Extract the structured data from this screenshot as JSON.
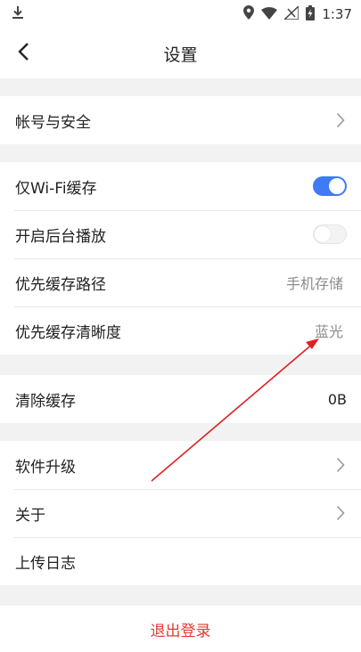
{
  "status_bar": {
    "time": "1:37"
  },
  "header": {
    "title": "设置"
  },
  "groups": [
    {
      "items": [
        {
          "label": "帐号与安全"
        }
      ]
    },
    {
      "items": [
        {
          "label": "仅Wi-Fi缓存",
          "toggle_on": true
        },
        {
          "label": "开启后台播放",
          "toggle_on": false
        },
        {
          "label": "优先缓存路径",
          "value": "手机存储"
        },
        {
          "label": "优先缓存清晰度",
          "value": "蓝光"
        }
      ]
    },
    {
      "items": [
        {
          "label": "清除缓存",
          "value": "0B"
        }
      ]
    },
    {
      "items": [
        {
          "label": "软件升级"
        },
        {
          "label": "关于"
        },
        {
          "label": "上传日志"
        }
      ]
    }
  ],
  "logout": {
    "label": "退出登录"
  },
  "colors": {
    "accent": "#3d7bf7",
    "danger": "#e53935",
    "annotation": "#e02020"
  }
}
